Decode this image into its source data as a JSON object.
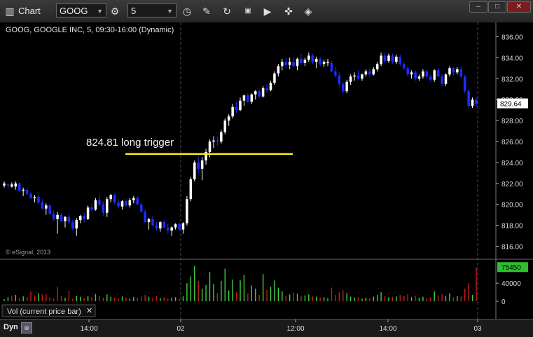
{
  "titlebar": {
    "app_title": "Chart",
    "symbol": "GOOG",
    "interval": "5",
    "icons": [
      "settings-icon",
      "clock-icon",
      "pencil-icon",
      "refresh-icon",
      "quote-icon",
      "play-icon",
      "cursor-icon",
      "eraser-icon"
    ]
  },
  "chart_data": {
    "type": "candlestick",
    "title": "GOOG, GOOGLE INC, 5, 09:30-16:00 (Dynamic)",
    "watermark": "© eSignal, 2013",
    "y_ticks": [
      "836.00",
      "834.00",
      "832.00",
      "830.00",
      "828.00",
      "826.00",
      "824.00",
      "822.00",
      "820.00",
      "818.00",
      "816.00"
    ],
    "ylim": [
      815.3,
      836.7
    ],
    "last_price": "829.64",
    "annotation": {
      "text": "824.81 long trigger",
      "level": 824.81
    },
    "x_ticks": [
      "14:00",
      "02",
      "12:00",
      "14:00",
      "03"
    ],
    "bars": [
      [
        822.0,
        822.2,
        821.6,
        821.8,
        "w"
      ],
      [
        821.8,
        822.0,
        821.5,
        821.9,
        "b"
      ],
      [
        821.9,
        822.1,
        821.6,
        821.7,
        "w"
      ],
      [
        821.7,
        822.2,
        821.4,
        822.0,
        "w"
      ],
      [
        822.0,
        822.1,
        821.2,
        821.3,
        "b"
      ],
      [
        821.3,
        821.6,
        820.8,
        821.4,
        "w"
      ],
      [
        821.4,
        821.6,
        820.9,
        821.0,
        "b"
      ],
      [
        821.0,
        821.2,
        820.5,
        820.6,
        "b"
      ],
      [
        820.6,
        820.9,
        820.2,
        820.7,
        "w"
      ],
      [
        820.7,
        820.9,
        820.0,
        820.2,
        "b"
      ],
      [
        820.2,
        820.5,
        819.5,
        819.6,
        "b"
      ],
      [
        819.6,
        820.1,
        819.0,
        819.9,
        "w"
      ],
      [
        819.9,
        820.0,
        819.0,
        819.1,
        "b"
      ],
      [
        819.1,
        819.4,
        818.4,
        818.6,
        "b"
      ],
      [
        818.6,
        819.3,
        817.2,
        819.0,
        "w"
      ],
      [
        819.0,
        819.2,
        818.3,
        818.4,
        "b"
      ],
      [
        818.4,
        818.9,
        817.8,
        818.8,
        "w"
      ],
      [
        818.8,
        819.1,
        818.1,
        818.3,
        "b"
      ],
      [
        818.3,
        818.5,
        817.5,
        817.7,
        "b"
      ],
      [
        817.7,
        818.7,
        817.0,
        818.5,
        "w"
      ],
      [
        818.5,
        819.0,
        818.2,
        818.9,
        "w"
      ],
      [
        818.9,
        819.2,
        818.3,
        818.6,
        "b"
      ],
      [
        818.6,
        819.9,
        818.5,
        819.7,
        "w"
      ],
      [
        819.7,
        820.1,
        819.3,
        819.5,
        "b"
      ],
      [
        819.5,
        820.6,
        819.4,
        820.4,
        "w"
      ],
      [
        820.4,
        820.9,
        819.8,
        820.0,
        "b"
      ],
      [
        820.0,
        820.3,
        818.9,
        819.2,
        "b"
      ],
      [
        819.2,
        820.7,
        818.8,
        820.5,
        "w"
      ],
      [
        820.5,
        821.0,
        820.2,
        820.9,
        "w"
      ],
      [
        820.9,
        821.1,
        820.0,
        820.2,
        "b"
      ],
      [
        820.2,
        820.5,
        819.6,
        819.8,
        "b"
      ],
      [
        819.8,
        820.4,
        819.5,
        820.3,
        "w"
      ],
      [
        820.3,
        820.5,
        819.8,
        819.9,
        "b"
      ],
      [
        819.9,
        820.6,
        819.7,
        820.4,
        "w"
      ],
      [
        820.4,
        820.8,
        820.1,
        820.6,
        "w"
      ],
      [
        820.6,
        820.8,
        819.9,
        820.0,
        "b"
      ],
      [
        820.0,
        820.2,
        819.2,
        819.3,
        "b"
      ],
      [
        819.3,
        819.5,
        818.2,
        818.3,
        "b"
      ],
      [
        818.3,
        818.7,
        817.6,
        818.6,
        "w"
      ],
      [
        818.6,
        818.9,
        817.9,
        818.0,
        "b"
      ],
      [
        818.0,
        818.3,
        817.5,
        817.7,
        "b"
      ],
      [
        817.7,
        818.4,
        817.4,
        818.3,
        "w"
      ],
      [
        818.3,
        818.5,
        817.7,
        817.8,
        "b"
      ],
      [
        817.8,
        818.1,
        817.2,
        817.5,
        "b"
      ],
      [
        817.5,
        817.9,
        817.0,
        817.8,
        "w"
      ],
      [
        817.8,
        818.2,
        817.6,
        818.1,
        "w"
      ],
      [
        818.1,
        818.3,
        817.5,
        817.6,
        "b"
      ],
      [
        817.6,
        818.3,
        817.2,
        818.2,
        "w"
      ],
      [
        818.2,
        820.8,
        818.0,
        820.5,
        "w"
      ],
      [
        820.5,
        822.6,
        820.3,
        822.4,
        "w"
      ],
      [
        822.4,
        824.2,
        822.2,
        824.0,
        "w"
      ],
      [
        824.0,
        824.7,
        823.0,
        823.4,
        "b"
      ],
      [
        823.4,
        824.5,
        822.3,
        824.2,
        "w"
      ],
      [
        824.2,
        825.3,
        823.8,
        825.0,
        "w"
      ],
      [
        825.0,
        826.2,
        824.5,
        826.0,
        "w"
      ],
      [
        826.0,
        826.5,
        825.4,
        826.1,
        "w"
      ],
      [
        826.1,
        826.5,
        825.6,
        826.0,
        "b"
      ],
      [
        826.0,
        827.1,
        825.8,
        826.9,
        "w"
      ],
      [
        826.9,
        828.2,
        826.7,
        828.0,
        "w"
      ],
      [
        828.0,
        828.6,
        827.5,
        828.4,
        "w"
      ],
      [
        828.4,
        829.6,
        828.2,
        829.3,
        "w"
      ],
      [
        829.3,
        829.8,
        828.7,
        829.0,
        "b"
      ],
      [
        829.0,
        830.2,
        828.9,
        829.9,
        "w"
      ],
      [
        829.9,
        830.5,
        829.4,
        830.4,
        "w"
      ],
      [
        830.4,
        830.6,
        829.7,
        829.8,
        "b"
      ],
      [
        829.8,
        830.6,
        829.6,
        830.5,
        "w"
      ],
      [
        830.5,
        830.9,
        830.0,
        830.8,
        "w"
      ],
      [
        830.8,
        831.0,
        830.2,
        830.3,
        "b"
      ],
      [
        830.3,
        831.3,
        830.2,
        831.1,
        "w"
      ],
      [
        831.1,
        831.5,
        830.7,
        830.9,
        "b"
      ],
      [
        830.9,
        831.8,
        830.8,
        831.6,
        "w"
      ],
      [
        831.6,
        832.7,
        831.4,
        832.5,
        "w"
      ],
      [
        832.5,
        833.4,
        832.2,
        833.2,
        "w"
      ],
      [
        833.2,
        833.9,
        832.8,
        833.6,
        "w"
      ],
      [
        833.6,
        834.0,
        833.0,
        833.3,
        "b"
      ],
      [
        833.3,
        834.0,
        832.9,
        833.6,
        "w"
      ],
      [
        833.6,
        834.0,
        833.1,
        833.2,
        "b"
      ],
      [
        833.2,
        834.0,
        832.8,
        833.9,
        "w"
      ],
      [
        833.9,
        834.4,
        833.3,
        833.5,
        "b"
      ],
      [
        833.5,
        834.0,
        833.2,
        833.8,
        "w"
      ],
      [
        833.8,
        834.5,
        833.6,
        834.2,
        "w"
      ],
      [
        834.2,
        834.4,
        833.4,
        833.6,
        "b"
      ],
      [
        833.6,
        834.1,
        833.0,
        833.9,
        "w"
      ],
      [
        833.9,
        834.1,
        833.2,
        833.4,
        "b"
      ],
      [
        833.4,
        833.8,
        833.1,
        833.6,
        "w"
      ],
      [
        833.6,
        833.9,
        833.2,
        833.5,
        "w"
      ],
      [
        833.5,
        833.7,
        832.6,
        832.7,
        "b"
      ],
      [
        832.7,
        833.1,
        832.1,
        832.3,
        "b"
      ],
      [
        832.3,
        832.6,
        831.2,
        831.5,
        "b"
      ],
      [
        831.5,
        831.7,
        830.6,
        830.8,
        "b"
      ],
      [
        830.8,
        831.9,
        830.6,
        831.7,
        "w"
      ],
      [
        831.7,
        832.4,
        831.4,
        832.2,
        "w"
      ],
      [
        832.2,
        832.6,
        831.8,
        832.3,
        "w"
      ],
      [
        832.3,
        832.8,
        831.9,
        832.0,
        "b"
      ],
      [
        832.0,
        832.5,
        831.8,
        832.4,
        "w"
      ],
      [
        832.4,
        832.9,
        832.2,
        832.7,
        "w"
      ],
      [
        832.7,
        833.0,
        832.2,
        832.4,
        "b"
      ],
      [
        832.4,
        833.1,
        832.3,
        832.9,
        "w"
      ],
      [
        832.9,
        833.6,
        832.7,
        833.4,
        "w"
      ],
      [
        833.4,
        834.5,
        833.2,
        834.2,
        "w"
      ],
      [
        834.2,
        834.5,
        833.5,
        833.7,
        "b"
      ],
      [
        833.7,
        834.4,
        833.5,
        834.2,
        "w"
      ],
      [
        834.2,
        834.4,
        833.4,
        833.6,
        "b"
      ],
      [
        833.6,
        834.3,
        833.4,
        834.1,
        "w"
      ],
      [
        834.1,
        834.3,
        833.2,
        833.4,
        "b"
      ],
      [
        833.4,
        833.6,
        832.8,
        833.0,
        "b"
      ],
      [
        833.0,
        833.2,
        832.2,
        832.4,
        "b"
      ],
      [
        832.4,
        832.8,
        832.0,
        832.6,
        "w"
      ],
      [
        832.6,
        832.8,
        831.8,
        832.0,
        "b"
      ],
      [
        832.0,
        832.4,
        831.8,
        832.2,
        "w"
      ],
      [
        832.2,
        832.9,
        832.0,
        832.7,
        "w"
      ],
      [
        832.7,
        832.9,
        832.0,
        832.2,
        "b"
      ],
      [
        832.2,
        832.4,
        831.7,
        831.9,
        "b"
      ],
      [
        831.9,
        832.9,
        831.7,
        832.8,
        "w"
      ],
      [
        832.8,
        833.0,
        832.1,
        832.2,
        "b"
      ],
      [
        832.2,
        832.4,
        831.3,
        831.5,
        "b"
      ],
      [
        831.5,
        832.5,
        831.3,
        832.4,
        "w"
      ],
      [
        832.4,
        833.2,
        832.2,
        833.0,
        "w"
      ],
      [
        833.0,
        833.1,
        832.3,
        832.6,
        "b"
      ],
      [
        832.6,
        833.1,
        832.4,
        832.9,
        "w"
      ],
      [
        832.9,
        833.2,
        832.1,
        832.2,
        "b"
      ],
      [
        832.2,
        832.4,
        830.6,
        830.8,
        "b"
      ],
      [
        830.8,
        831.0,
        829.2,
        829.4,
        "b"
      ],
      [
        829.4,
        830.2,
        829.2,
        830.0,
        "w"
      ],
      [
        830.0,
        830.2,
        829.3,
        829.6,
        "b"
      ]
    ],
    "volume": {
      "label": "Vol (current price bar)",
      "last": "75450",
      "y_ticks": [
        "40000",
        "0"
      ],
      "ylim": [
        0,
        82000
      ],
      "bars": [
        [
          5000,
          "g"
        ],
        [
          9000,
          "g"
        ],
        [
          12000,
          "r"
        ],
        [
          14000,
          "g"
        ],
        [
          7000,
          "r"
        ],
        [
          11000,
          "g"
        ],
        [
          9000,
          "r"
        ],
        [
          22000,
          "r"
        ],
        [
          13000,
          "r"
        ],
        [
          18000,
          "g"
        ],
        [
          15000,
          "r"
        ],
        [
          16000,
          "r"
        ],
        [
          9000,
          "r"
        ],
        [
          6000,
          "r"
        ],
        [
          32000,
          "r"
        ],
        [
          12000,
          "r"
        ],
        [
          8000,
          "g"
        ],
        [
          23000,
          "r"
        ],
        [
          6000,
          "r"
        ],
        [
          12000,
          "g"
        ],
        [
          10000,
          "g"
        ],
        [
          7000,
          "r"
        ],
        [
          12000,
          "g"
        ],
        [
          9000,
          "r"
        ],
        [
          16000,
          "g"
        ],
        [
          11000,
          "r"
        ],
        [
          8000,
          "r"
        ],
        [
          15000,
          "g"
        ],
        [
          10000,
          "g"
        ],
        [
          8000,
          "r"
        ],
        [
          6000,
          "r"
        ],
        [
          11000,
          "g"
        ],
        [
          8000,
          "r"
        ],
        [
          6000,
          "g"
        ],
        [
          9000,
          "g"
        ],
        [
          8000,
          "r"
        ],
        [
          11000,
          "r"
        ],
        [
          14000,
          "r"
        ],
        [
          10000,
          "g"
        ],
        [
          7000,
          "r"
        ],
        [
          11000,
          "r"
        ],
        [
          7000,
          "g"
        ],
        [
          9000,
          "r"
        ],
        [
          6000,
          "r"
        ],
        [
          8000,
          "g"
        ],
        [
          9000,
          "g"
        ],
        [
          5000,
          "r"
        ],
        [
          11000,
          "g"
        ],
        [
          40000,
          "g"
        ],
        [
          55000,
          "g"
        ],
        [
          78000,
          "g"
        ],
        [
          45000,
          "r"
        ],
        [
          28000,
          "g"
        ],
        [
          36000,
          "g"
        ],
        [
          65000,
          "g"
        ],
        [
          38000,
          "g"
        ],
        [
          18000,
          "r"
        ],
        [
          45000,
          "g"
        ],
        [
          72000,
          "g"
        ],
        [
          24000,
          "g"
        ],
        [
          48000,
          "g"
        ],
        [
          20000,
          "r"
        ],
        [
          46000,
          "g"
        ],
        [
          58000,
          "g"
        ],
        [
          17000,
          "r"
        ],
        [
          35000,
          "g"
        ],
        [
          28000,
          "g"
        ],
        [
          14000,
          "r"
        ],
        [
          60000,
          "g"
        ],
        [
          25000,
          "r"
        ],
        [
          32000,
          "g"
        ],
        [
          46000,
          "g"
        ],
        [
          30000,
          "g"
        ],
        [
          22000,
          "g"
        ],
        [
          12000,
          "r"
        ],
        [
          15000,
          "g"
        ],
        [
          19000,
          "r"
        ],
        [
          17000,
          "g"
        ],
        [
          12000,
          "r"
        ],
        [
          13000,
          "g"
        ],
        [
          15000,
          "g"
        ],
        [
          11000,
          "r"
        ],
        [
          10000,
          "g"
        ],
        [
          8000,
          "r"
        ],
        [
          9000,
          "g"
        ],
        [
          7000,
          "g"
        ],
        [
          30000,
          "r"
        ],
        [
          14000,
          "r"
        ],
        [
          20000,
          "r"
        ],
        [
          24000,
          "r"
        ],
        [
          18000,
          "g"
        ],
        [
          10000,
          "g"
        ],
        [
          8000,
          "g"
        ],
        [
          9000,
          "r"
        ],
        [
          6000,
          "g"
        ],
        [
          8000,
          "g"
        ],
        [
          7000,
          "r"
        ],
        [
          10000,
          "g"
        ],
        [
          14000,
          "g"
        ],
        [
          20000,
          "g"
        ],
        [
          12000,
          "r"
        ],
        [
          9000,
          "g"
        ],
        [
          10000,
          "r"
        ],
        [
          11000,
          "g"
        ],
        [
          14000,
          "r"
        ],
        [
          12000,
          "r"
        ],
        [
          16000,
          "r"
        ],
        [
          9000,
          "g"
        ],
        [
          12000,
          "r"
        ],
        [
          8000,
          "g"
        ],
        [
          10000,
          "g"
        ],
        [
          7000,
          "r"
        ],
        [
          9000,
          "r"
        ],
        [
          22000,
          "g"
        ],
        [
          13000,
          "r"
        ],
        [
          16000,
          "r"
        ],
        [
          12000,
          "g"
        ],
        [
          18000,
          "g"
        ],
        [
          9000,
          "r"
        ],
        [
          12000,
          "g"
        ],
        [
          11000,
          "r"
        ],
        [
          28000,
          "r"
        ],
        [
          40000,
          "r"
        ],
        [
          14000,
          "g"
        ],
        [
          75450,
          "r"
        ]
      ]
    }
  },
  "bottombar": {
    "label": "Dyn"
  }
}
